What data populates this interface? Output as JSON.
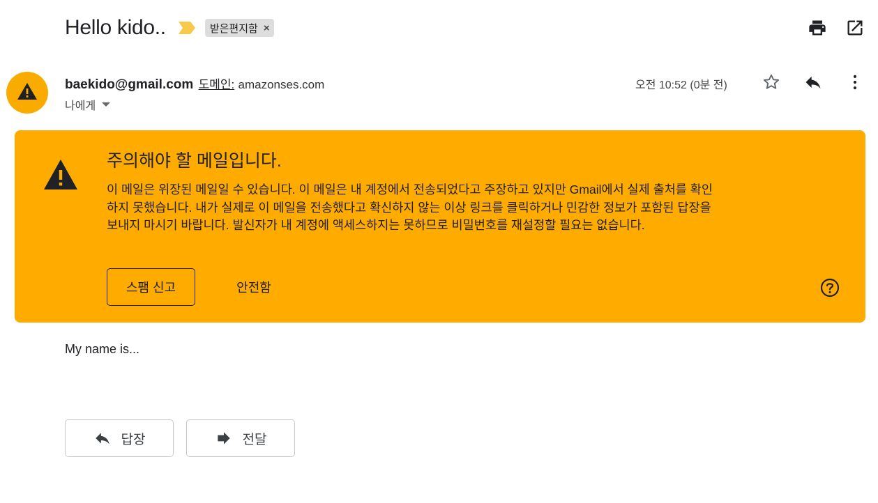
{
  "header": {
    "subject": "Hello kido..",
    "label_chip": "받은편지함",
    "label_chip_remove": "×",
    "icons": [
      "importance-marker-icon",
      "print-icon",
      "open-in-new-window-icon"
    ]
  },
  "sender": {
    "email": "baekido@gmail.com",
    "domain_label": "도메인:",
    "domain_value": "amazonses.com",
    "recipient": "나에게",
    "timestamp": "오전 10:52 (0분 전)",
    "avatar_icon": "warning-icon",
    "icons": [
      "star-icon",
      "reply-icon",
      "more-vert-icon"
    ]
  },
  "warning": {
    "title": "주의해야 할 메일입니다.",
    "body": "이 메일은 위장된 메일일 수 있습니다. 이 메일은 내 계정에서 전송되었다고 주장하고 있지만 Gmail에서 실제 출처를 확인하지 못했습니다. 내가 실제로 이 메일을 전송했다고 확신하지 않는 이상 링크를 클릭하거나 민감한 정보가 포함된 답장을 보내지 마시기 바랍니다. 발신자가 내 계정에 액세스하지는 못하므로 비밀번호를 재설정할 필요는 없습니다.",
    "spam_button": "스팸 신고",
    "safe_button": "안전함",
    "icons": [
      "warning-icon",
      "help-icon"
    ]
  },
  "message": {
    "body": "My name is..."
  },
  "actions": {
    "reply_label": "답장",
    "forward_label": "전달",
    "icons": [
      "reply-icon",
      "forward-icon"
    ]
  },
  "colors": {
    "warning_bg": "#ffab00",
    "avatar_bg": "#f9ab00",
    "importance_marker": "#f8c94a",
    "label_chip_bg": "#dddddd"
  }
}
